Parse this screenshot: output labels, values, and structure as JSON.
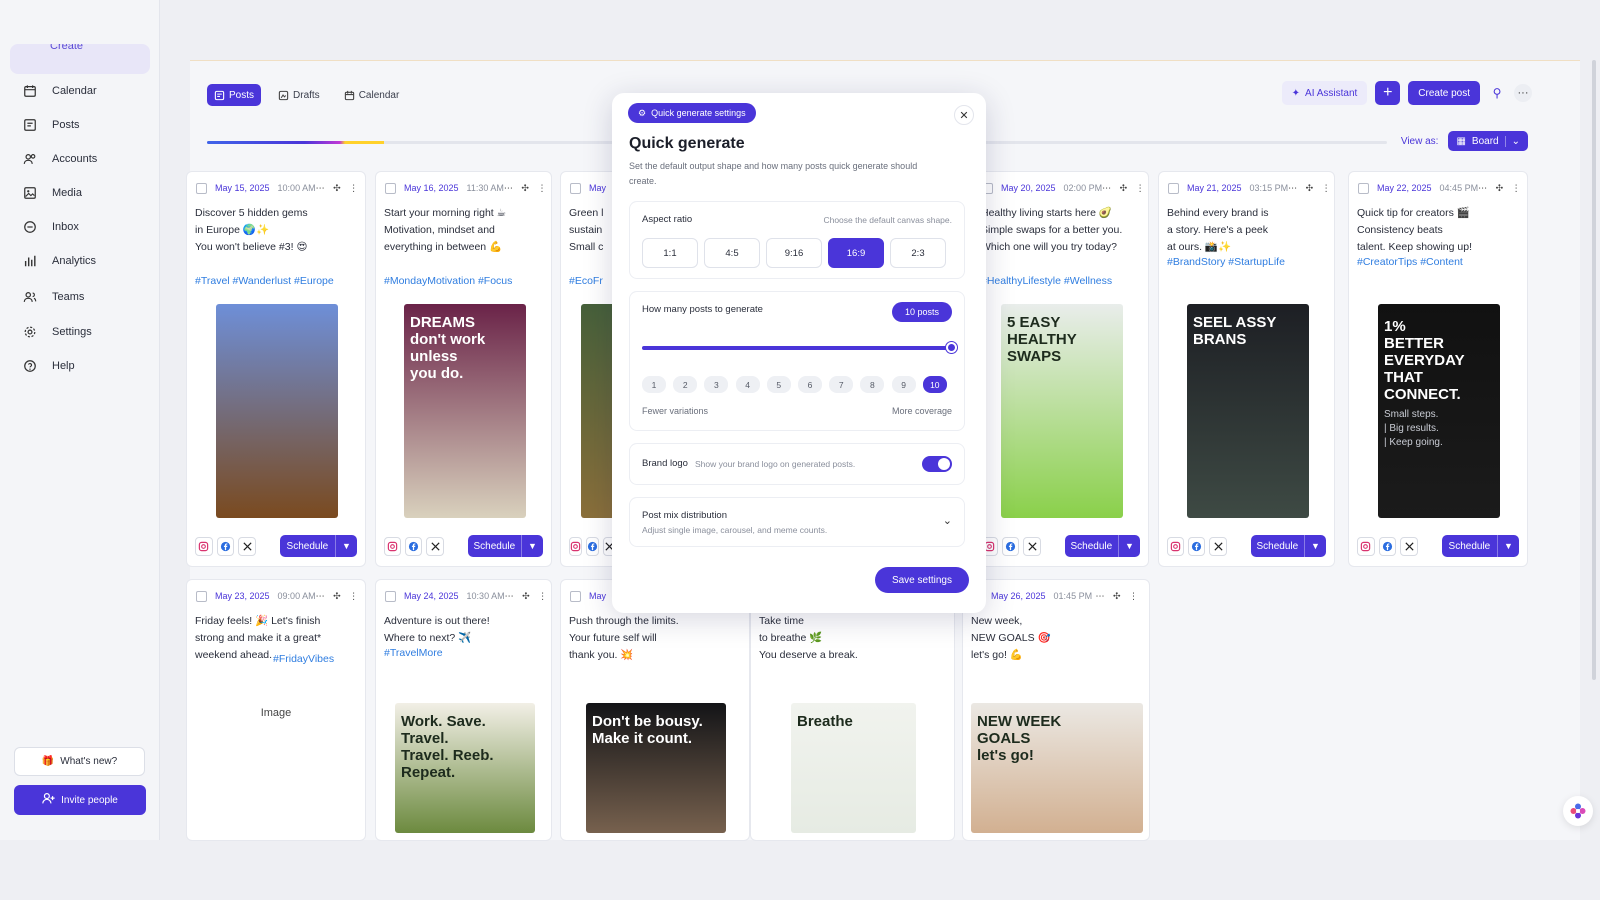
{
  "sidebar": {
    "active_item": "Create",
    "items": [
      {
        "label": "Calendar",
        "icon": "calendar-icon"
      },
      {
        "label": "Posts",
        "icon": "posts-icon"
      },
      {
        "label": "Accounts",
        "icon": "accounts-icon"
      },
      {
        "label": "Media",
        "icon": "media-icon"
      },
      {
        "label": "Inbox",
        "icon": "inbox-icon"
      },
      {
        "label": "Analytics",
        "icon": "analytics-icon"
      },
      {
        "label": "Teams",
        "icon": "teams-icon"
      },
      {
        "label": "Settings",
        "icon": "settings-icon"
      },
      {
        "label": "Help",
        "icon": "help-icon"
      }
    ],
    "whats_new": "What's new?",
    "invite": "Invite people"
  },
  "toolbar": {
    "tabs": [
      "Posts",
      "Drafts",
      "Calendar"
    ],
    "active_tab": "Posts",
    "ai_assistant": "AI Assistant",
    "create_post": "Create post",
    "view_as_label": "View as:",
    "view_mode": "Board",
    "progress_fraction": 0.15
  },
  "cards": [
    {
      "date": "May 15, 2025",
      "time": "10:00 AM",
      "text": "Discover 5 hidden gems\nin Europe 🌍✨\nYou won't believe #3! 😍",
      "tags": "#Travel #Wanderlust #Europe",
      "schedule": "Schedule",
      "image": {
        "top": "#6e8fd8",
        "bottom": "#7a4a1f"
      }
    },
    {
      "date": "May 16, 2025",
      "time": "11:30 AM",
      "text": "Start your morning right ☕\nMotivation, mindset and\neverything in between 💪",
      "tags": "#MondayMotivation #Focus",
      "schedule": "Schedule",
      "image": {
        "top": "#6a2348",
        "bottom": "#d9d1bd",
        "text1": "DREAMS\ndon't work\nunless\nyou do."
      }
    },
    {
      "date": "May",
      "time": "",
      "text": "Green l\nsustain\nSmall c",
      "tags": "#EcoFr",
      "schedule": "",
      "image": {
        "top": "#46603a",
        "bottom": "#8a6f3a"
      }
    },
    {
      "date": "May 20, 2025",
      "time": "02:00 PM",
      "text": "Healthy living starts here 🥑\nSimple swaps for a better you.\nWhich one will you try today?",
      "tags": "#HealthyLifestyle #Wellness",
      "schedule": "Schedule",
      "image": {
        "top": "#e9edeb",
        "bottom": "#8ad04a",
        "text1": "5 EASY\nHEALTHY SWAPS"
      }
    },
    {
      "date": "May 21, 2025",
      "time": "03:15 PM",
      "text": "Behind every brand is\na story. Here's a peek\nat ours. 📸✨",
      "tags": "#BrandStory #StartupLife",
      "schedule": "Schedule",
      "image": {
        "top": "#1d1f24",
        "bottom": "#3e4a44",
        "text1": "SEEL ASSY\nBRANS"
      }
    },
    {
      "date": "May 22, 2025",
      "time": "04:45 PM",
      "text": "Quick tip for creators 🎬\nConsistency beats\ntalent. Keep showing up!",
      "tags": "#CreatorTips #Content",
      "schedule": "Schedule",
      "image": {
        "top": "#111",
        "bottom": "#1b1b1b",
        "text1": "1%\nBETTER\nEVERYDAY\nTHAT CONNECT.",
        "text2": "Small steps.\n| Big results.\n| Keep going."
      }
    },
    {
      "date": "May 23, 2025",
      "time": "09:00 AM",
      "text": "Friday feels! 🎉 Let's finish\nstrong and make it a great*\nweekend ahead. ",
      "tags": "#FridayVibes",
      "placeholder": "Image"
    },
    {
      "date": "May 24, 2025",
      "time": "10:30 AM",
      "text": "Adventure is out there!\nWhere to next? ✈️",
      "tags": "#TravelMore",
      "image": {
        "top": "#f2efe6",
        "bottom": "#6c8a3f",
        "text1": "Work. Save.\nTravel.\nTravel. Reeb.\nRepeat."
      }
    },
    {
      "date": "May",
      "time": "",
      "text": "Push through the limits.\nYour future self will\nthank you. 💥",
      "tags": "",
      "image": {
        "top": "#131417",
        "bottom": "#77614e",
        "text1": "Don't be bousy.\nMake it count."
      }
    },
    {
      "date": "",
      "time": "",
      "text": "Take time\nto breathe 🌿\nYou deserve a break.",
      "tags": "",
      "image": {
        "top": "#f1f3ee",
        "bottom": "#e6ebe3",
        "text1": "Breathe"
      }
    },
    {
      "date": "May 26, 2025",
      "time": "01:45 PM",
      "text": "New week,\nNEW GOALS 🎯\nlet's go! 💪",
      "tags": "",
      "image": {
        "top": "#ebe8e3",
        "bottom": "#d2b091",
        "text1": "NEW WEEK\nGOALS\nlet's go!"
      }
    }
  ],
  "modal": {
    "badge": "Quick generate settings",
    "title": "Quick generate",
    "description": "Set the default output shape and how many posts quick generate should create.",
    "aspect": {
      "label": "Aspect ratio",
      "hint": "Choose the default canvas shape.",
      "options": [
        "1:1",
        "4:5",
        "9:16",
        "16:9",
        "2:3"
      ],
      "selected": "16:9"
    },
    "count": {
      "label": "How many posts to generate",
      "pill": "10 posts",
      "value": 10,
      "max": 10,
      "options": [
        "1",
        "2",
        "3",
        "4",
        "5",
        "6",
        "7",
        "8",
        "9",
        "10"
      ],
      "low_label": "Fewer variations",
      "high_label": "More coverage"
    },
    "brand_logo": {
      "label": "Brand logo",
      "hint": "Show your brand logo on generated posts.",
      "enabled": true
    },
    "post_mix": {
      "label": "Post mix distribution",
      "hint": "Adjust single image, carousel, and meme counts."
    },
    "save": "Save settings"
  },
  "colors": {
    "accent": "#4a35d9",
    "hashtag": "#2f7de0",
    "date": "#4a35d9"
  }
}
